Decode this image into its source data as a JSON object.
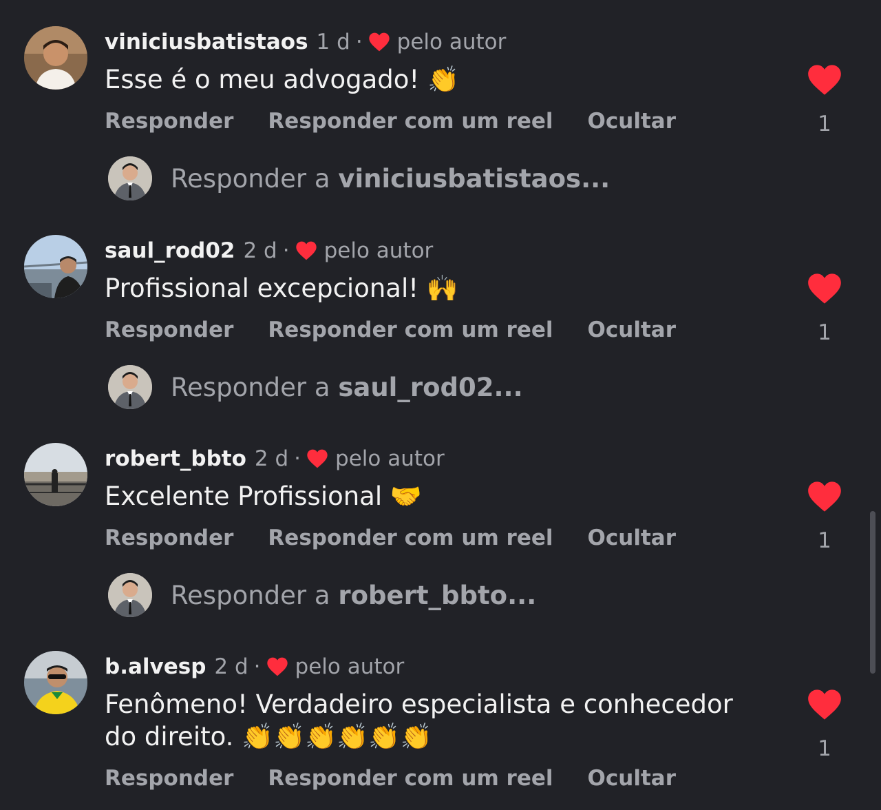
{
  "colors": {
    "background": "#212227",
    "text_primary": "#f2f2f2",
    "text_secondary": "#a3a5ab",
    "heart": "#ff2d3d"
  },
  "comments": [
    {
      "username": "viniciusbatistaos",
      "time": "1 d",
      "separator": "·",
      "author_like_label": "pelo autor",
      "text": "Esse é o meu advogado! 👏",
      "actions": {
        "reply": "Responder",
        "reply_reel": "Responder com um reel",
        "hide": "Ocultar"
      },
      "like_icon": "heart-filled-icon",
      "like_count": "1",
      "reply_prefix": "Responder a",
      "reply_target": "viniciusbatistaos..."
    },
    {
      "username": "saul_rod02",
      "time": "2 d",
      "separator": "·",
      "author_like_label": "pelo autor",
      "text": "Profissional excepcional! 🙌",
      "actions": {
        "reply": "Responder",
        "reply_reel": "Responder com um reel",
        "hide": "Ocultar"
      },
      "like_icon": "heart-filled-icon",
      "like_count": "1",
      "reply_prefix": "Responder a",
      "reply_target": "saul_rod02..."
    },
    {
      "username": "robert_bbto",
      "time": "2 d",
      "separator": "·",
      "author_like_label": "pelo autor",
      "text": "Excelente Profissional 🤝",
      "actions": {
        "reply": "Responder",
        "reply_reel": "Responder com um reel",
        "hide": "Ocultar"
      },
      "like_icon": "heart-filled-icon",
      "like_count": "1",
      "reply_prefix": "Responder a",
      "reply_target": "robert_bbto..."
    },
    {
      "username": "b.alvesp",
      "time": "2 d",
      "separator": "·",
      "author_like_label": "pelo autor",
      "text": "Fenômeno! Verdadeiro especialista e conhecedor do direito. 👏👏👏👏👏👏",
      "actions": {
        "reply": "Responder",
        "reply_reel": "Responder com um reel",
        "hide": "Ocultar"
      },
      "like_icon": "heart-filled-icon",
      "like_count": "1"
    }
  ]
}
